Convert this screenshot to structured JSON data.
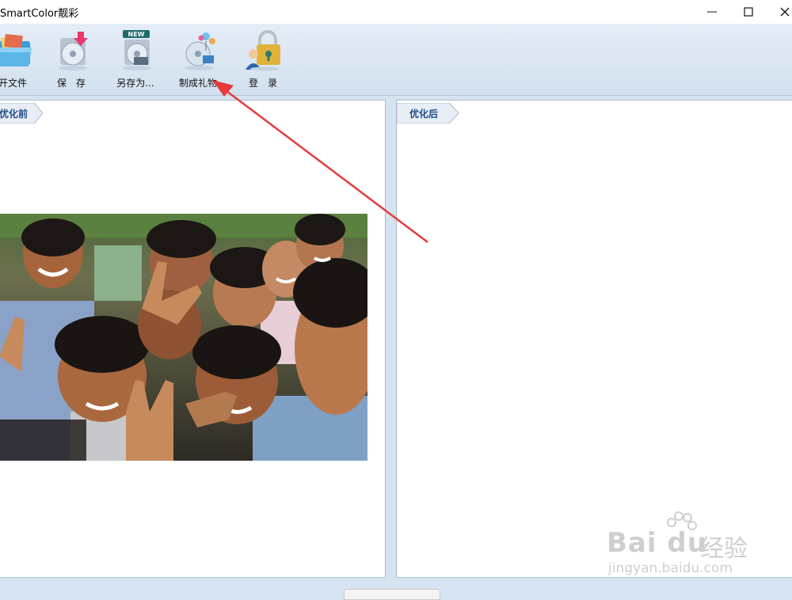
{
  "window": {
    "title": "SmartColor靓彩",
    "min_glyph": "—",
    "max_glyph": "☐",
    "close_glyph": "✕"
  },
  "toolbar": {
    "items": [
      {
        "label": "开文件",
        "icon": "open-folder-icon"
      },
      {
        "label": "保　存",
        "icon": "save-disc-icon"
      },
      {
        "label": "另存为...",
        "icon": "save-as-new-icon",
        "badge": "NEW"
      },
      {
        "label": "制成礼物",
        "icon": "gift-disc-icon"
      },
      {
        "label": "登　录",
        "icon": "login-lock-icon"
      }
    ]
  },
  "panels": {
    "before": {
      "label": "优化前"
    },
    "after": {
      "label": "优化后"
    }
  },
  "watermark": {
    "logo": "Bai du",
    "cn": "经验",
    "url": "jingyan.baidu.com"
  },
  "colors": {
    "accent": "#1f4a86",
    "annotation": "#e83a3a",
    "background": "#d6e3f0"
  }
}
